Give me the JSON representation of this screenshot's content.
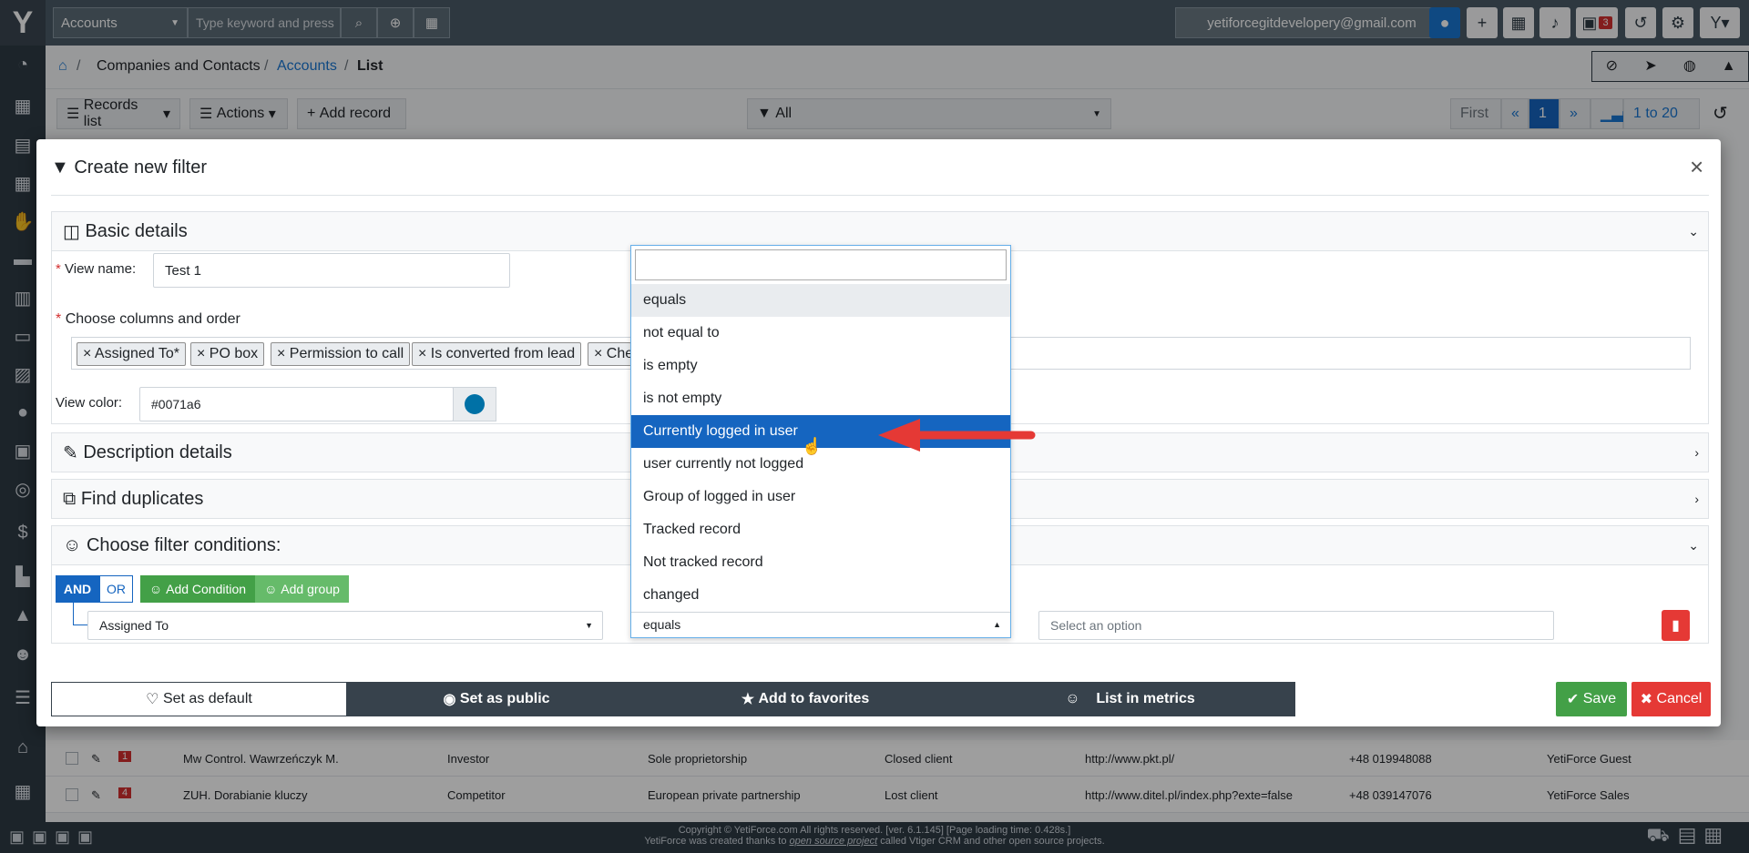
{
  "topbar": {
    "module_select": "Accounts",
    "search_placeholder": "Type keyword and press",
    "email": "yetiforcegitdevelopery@gmail.com",
    "calendar_badge": "3"
  },
  "breadcrumb": {
    "root": "Companies and Contacts",
    "module": "Accounts",
    "current": "List"
  },
  "toolbar": {
    "records_list": "Records list",
    "actions": "Actions",
    "add_record": "Add record",
    "filter_value": "All",
    "pager_first": "First",
    "pager_prev": "«",
    "pager_page": "1",
    "pager_next": "»",
    "pager_range": "1 to 20"
  },
  "table_rows": [
    {
      "badge": "1",
      "name": "Mw Control. Wawrzeńczyk M.",
      "type": "Investor",
      "legal": "Sole proprietorship",
      "status": "Closed client",
      "url": "http://www.pkt.pl/",
      "phone": "+48 019948088",
      "owner": "YetiForce Guest"
    },
    {
      "badge": "4",
      "name": "ZUH. Dorabianie kluczy",
      "type": "Competitor",
      "legal": "European private partnership",
      "status": "Lost client",
      "url": "http://www.ditel.pl/index.php?exte=false",
      "phone": "+48 039147076",
      "owner": "YetiForce Sales"
    }
  ],
  "footer": {
    "line1": "Copyright © YetiForce.com All rights reserved. [ver. 6.1.145] [Page loading time: 0.428s.]",
    "line2_pre": "YetiForce was created thanks to",
    "line2_link": "open source project",
    "line2_post": "called Vtiger CRM and other open source projects."
  },
  "modal": {
    "title": "Create new filter",
    "close": "×",
    "basic_details": "Basic details",
    "view_name_label": "View name:",
    "view_name_value": "Test 1",
    "columns_label": "Choose columns and order",
    "columns": [
      "× Assigned To*",
      "× PO box",
      "× Permission to call",
      "× Is converted from lead",
      "× Che"
    ],
    "view_color_label": "View color:",
    "view_color_value": "#0071a6",
    "description_details": "Description details",
    "find_duplicates": "Find duplicates",
    "filter_conditions": "Choose filter conditions:",
    "and_label": "AND",
    "or_label": "OR",
    "add_condition": "Add Condition",
    "add_group": "Add group",
    "condition_field": "Assigned To",
    "condition_operator": "equals",
    "condition_value_placeholder": "Select an option",
    "set_default": "Set as default",
    "set_public": "Set as public",
    "add_favorites": "Add to favorites",
    "list_metrics": "List in metrics",
    "save": "Save",
    "cancel": "Cancel"
  },
  "dropdown": {
    "options": [
      "equals",
      "not equal to",
      "is empty",
      "is not empty",
      "Currently logged in user",
      "user currently not logged",
      "Group of logged in user",
      "Tracked record",
      "Not tracked record",
      "changed"
    ],
    "highlighted": "Currently logged in user"
  },
  "colors": {
    "primary": "#1565c0",
    "success": "#43a047",
    "danger": "#e53935",
    "dark": "#37424c",
    "view_color": "#0071a6",
    "arrow": "#e53935"
  }
}
